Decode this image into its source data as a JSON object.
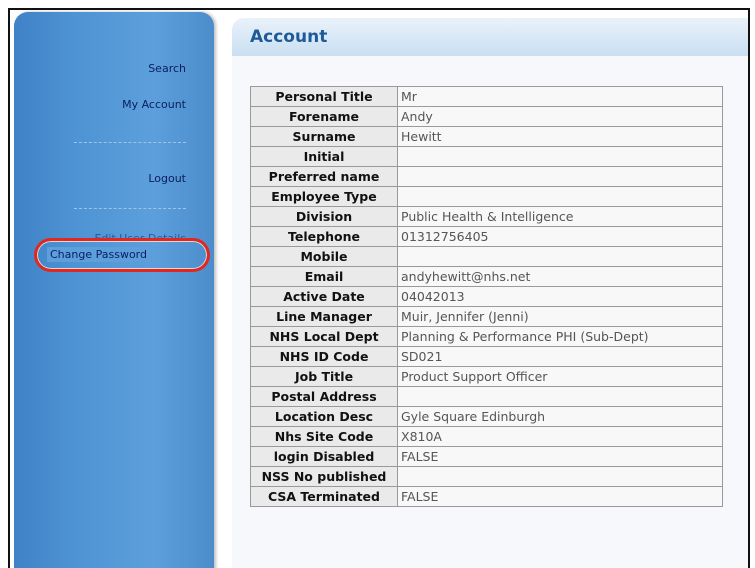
{
  "sidebar": {
    "search": "Search",
    "my_account": "My Account",
    "separator1": "",
    "logout": "Logout",
    "separator2": "",
    "edit_user_details": "Edit User Details",
    "change_password": "Change Password"
  },
  "main": {
    "title": "Account"
  },
  "details": [
    {
      "label": "Personal Title",
      "value": "Mr"
    },
    {
      "label": "Forename",
      "value": "Andy"
    },
    {
      "label": "Surname",
      "value": "Hewitt"
    },
    {
      "label": "Initial",
      "value": ""
    },
    {
      "label": "Preferred name",
      "value": ""
    },
    {
      "label": "Employee Type",
      "value": ""
    },
    {
      "label": "Division",
      "value": "Public Health & Intelligence"
    },
    {
      "label": "Telephone",
      "value": "01312756405"
    },
    {
      "label": "Mobile",
      "value": ""
    },
    {
      "label": "Email",
      "value": "andyhewitt@nhs.net"
    },
    {
      "label": "Active Date",
      "value": "04042013"
    },
    {
      "label": "Line Manager",
      "value": "Muir, Jennifer (Jenni)"
    },
    {
      "label": "NHS Local Dept",
      "value": "Planning & Performance PHI (Sub-Dept)"
    },
    {
      "label": "NHS ID Code",
      "value": "SD021"
    },
    {
      "label": "Job Title",
      "value": "Product Support Officer"
    },
    {
      "label": "Postal Address",
      "value": ""
    },
    {
      "label": "Location Desc",
      "value": "Gyle Square Edinburgh"
    },
    {
      "label": "Nhs Site Code",
      "value": "X810A"
    },
    {
      "label": "login Disabled",
      "value": "FALSE"
    },
    {
      "label": "NSS No published",
      "value": ""
    },
    {
      "label": "CSA Terminated",
      "value": "FALSE"
    }
  ],
  "colors": {
    "sidebar": "#4e93d3",
    "highlight_ring": "#e3271f",
    "title": "#1f5a98"
  }
}
